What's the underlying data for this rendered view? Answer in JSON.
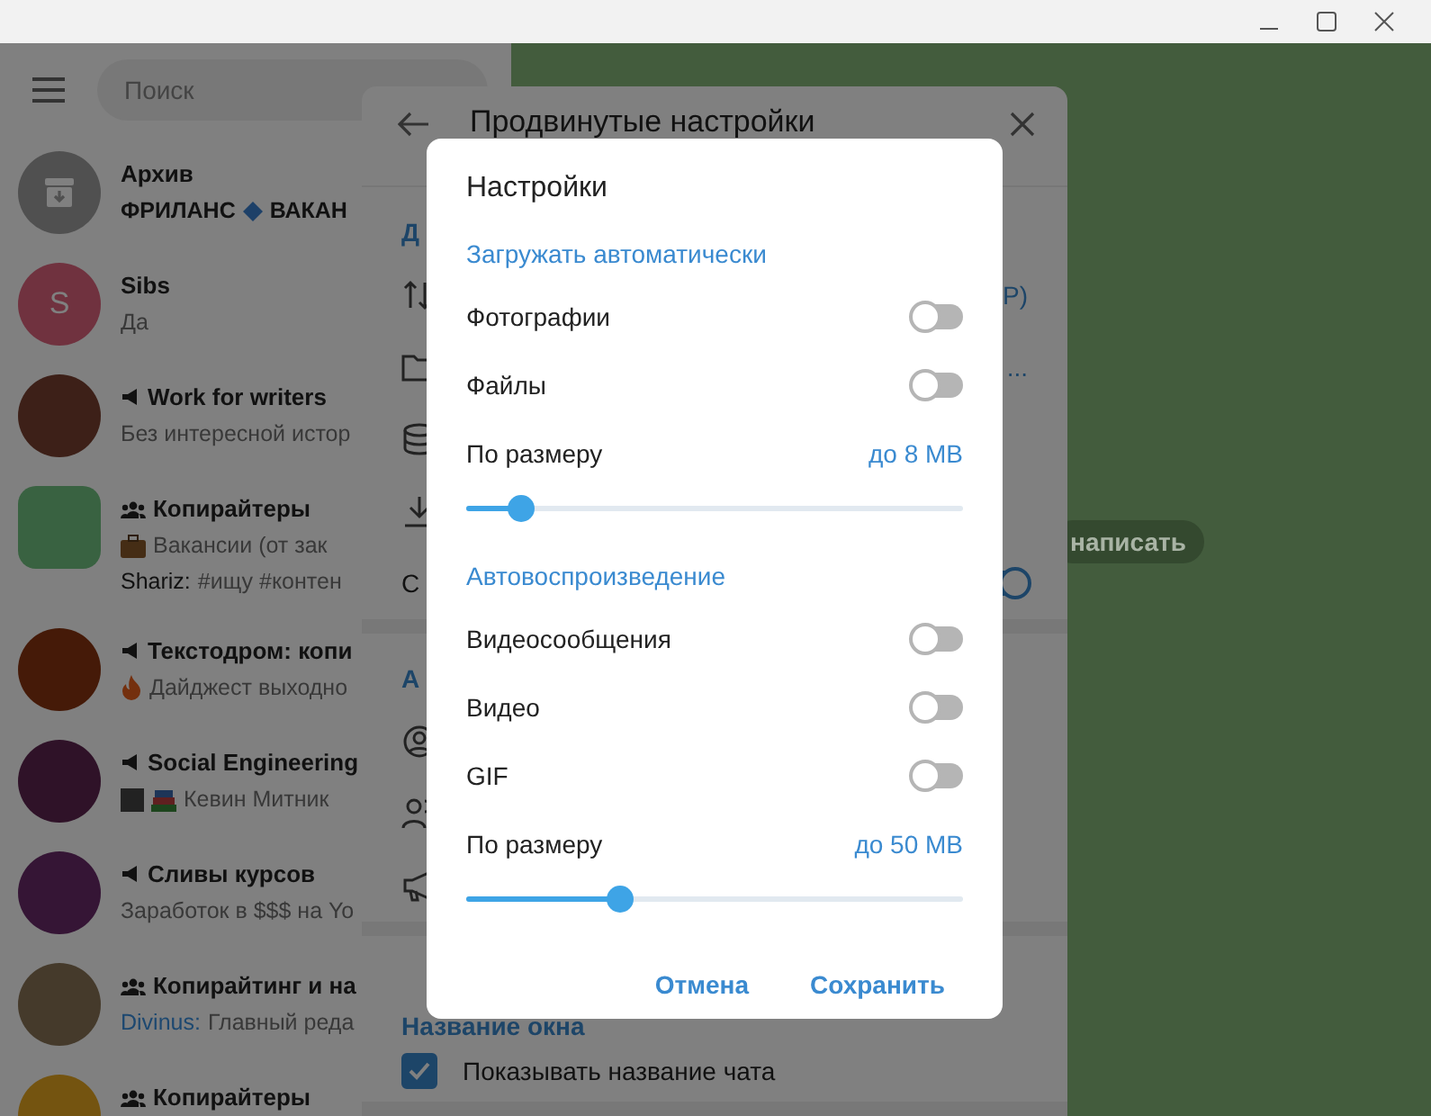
{
  "search": {
    "placeholder": "Поиск"
  },
  "chats": [
    {
      "kind": "archive",
      "name": "Архив",
      "color": "#505050",
      "preview": "ФРИЛАНС",
      "preview_tail": "ВАКАН"
    },
    {
      "kind": "user",
      "name": "Sibs",
      "initial": "S",
      "color": "#70323f",
      "preview": "Да"
    },
    {
      "kind": "channel",
      "name": "Work for writers",
      "color": "#3d2018",
      "preview": "Без интересной истор"
    },
    {
      "kind": "group",
      "name": "Копирайтеры",
      "color": "#396241",
      "preview": "Вакансии (от зак",
      "extra_sender": "Shariz:",
      "extra": "#ищу #контен"
    },
    {
      "kind": "channel",
      "name": "Текстодром: копи",
      "color": "#451a08",
      "preview": "Дайджест выходно"
    },
    {
      "kind": "channel",
      "name": "Social Engineering",
      "color": "#2f1228",
      "preview": "Кевин Митник"
    },
    {
      "kind": "channel",
      "name": "Сливы курсов",
      "color": "#351535",
      "preview": "Заработок в $$$ на Yo"
    },
    {
      "kind": "group",
      "name": "Копирайтинг и на",
      "color": "#453a2b",
      "sender": "Divinus:",
      "preview": "Главный реда"
    },
    {
      "kind": "group",
      "name": "Копирайтеры",
      "color": "#745410"
    }
  ],
  "chat_hint": "написать",
  "panel": {
    "title": "Продвинутые настройки",
    "sections": [
      {
        "heading": "Д",
        "rows": [
          {
            "kind": "item",
            "value": "Р)"
          },
          {
            "kind": "item",
            "value": "..."
          },
          {
            "kind": "item"
          },
          {
            "kind": "item"
          },
          {
            "kind": "toggle",
            "label": "С",
            "on": true
          }
        ]
      },
      {
        "heading": "А",
        "rows": [
          {
            "kind": "item"
          },
          {
            "kind": "item"
          },
          {
            "kind": "item"
          }
        ]
      },
      {
        "heading": "Название окна",
        "rows": [
          {
            "kind": "checkbox",
            "label": "Показывать название чата",
            "checked": true
          }
        ]
      }
    ]
  },
  "dialog": {
    "title": "Настройки",
    "sections": [
      {
        "heading": "Загружать автоматически",
        "toggles": [
          {
            "label": "Фотографии",
            "on": false
          },
          {
            "label": "Файлы",
            "on": false
          }
        ],
        "slider": {
          "label": "По размеру",
          "reading": "до 8 MB",
          "level": 0.09
        }
      },
      {
        "heading": "Автовоспроизведение",
        "toggles": [
          {
            "label": "Видеосообщения",
            "on": false
          },
          {
            "label": "Видео",
            "on": false
          },
          {
            "label": "GIF",
            "on": false
          }
        ],
        "slider": {
          "label": "По размеру",
          "reading": "до 50 MB",
          "level": 0.3
        }
      }
    ],
    "buttons": [
      "Отмена",
      "Сохранить"
    ]
  }
}
